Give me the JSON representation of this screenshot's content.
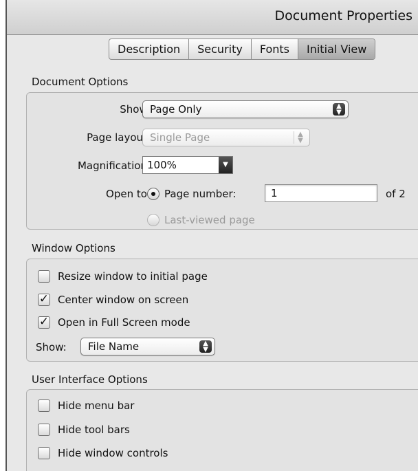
{
  "window": {
    "title": "Document Properties"
  },
  "tabs": [
    {
      "label": "Description",
      "active": false
    },
    {
      "label": "Security",
      "active": false
    },
    {
      "label": "Fonts",
      "active": false
    },
    {
      "label": "Initial View",
      "active": true
    }
  ],
  "document_options": {
    "heading": "Document Options",
    "show_label": "Show:",
    "show_value": "Page Only",
    "page_layout_label": "Page layout:",
    "page_layout_value": "Single Page",
    "magnification_label": "Magnification:",
    "magnification_value": "100%",
    "open_to_label": "Open to:",
    "page_number_label": "Page number:",
    "page_number_value": "1",
    "page_count": "of 2",
    "last_viewed_label": "Last-viewed page"
  },
  "window_options": {
    "heading": "Window Options",
    "resize_label": "Resize window to initial page",
    "resize_checked": false,
    "center_label": "Center window on screen",
    "center_checked": true,
    "fullscreen_label": "Open in Full Screen mode",
    "fullscreen_checked": true,
    "show_label": "Show:",
    "show_value": "File Name"
  },
  "ui_options": {
    "heading": "User Interface Options",
    "hide_menu_label": "Hide menu bar",
    "hide_menu_checked": false,
    "hide_toolbars_label": "Hide tool bars",
    "hide_toolbars_checked": false,
    "hide_controls_label": "Hide window controls",
    "hide_controls_checked": false
  },
  "icons": {
    "popup_arrows": "updown-arrows-icon",
    "dropdown": "chevron-down-icon",
    "check": "checkmark-icon"
  }
}
